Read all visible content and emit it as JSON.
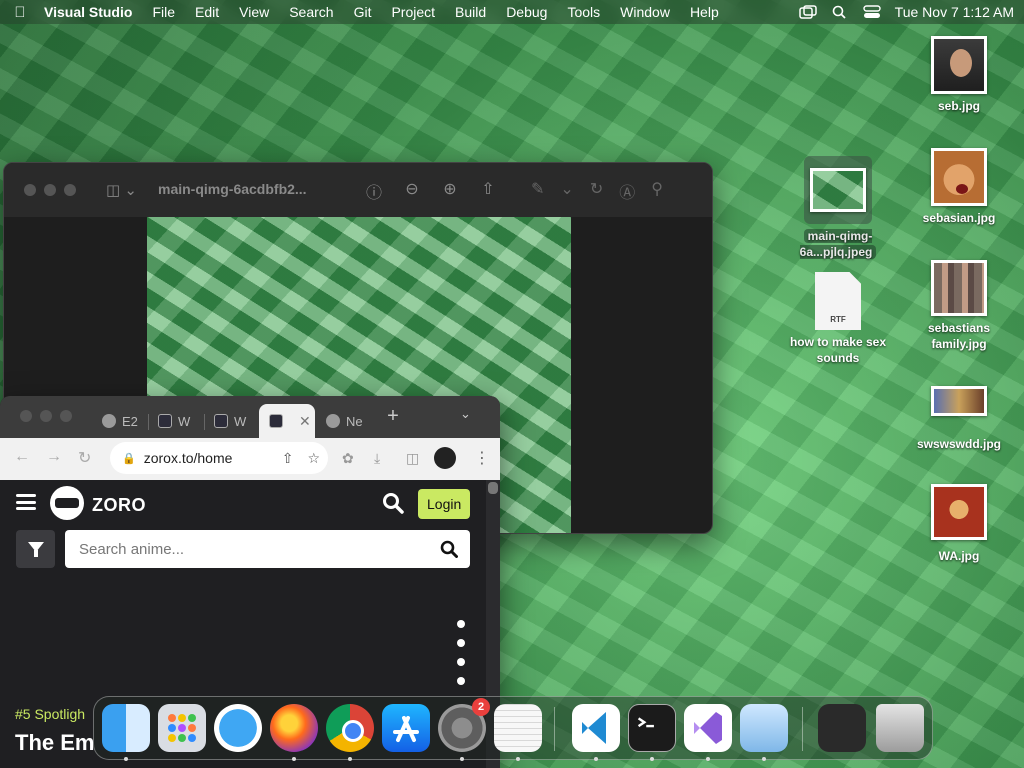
{
  "menubar": {
    "app_name": "Visual Studio",
    "menus": [
      "File",
      "Edit",
      "View",
      "Search",
      "Git",
      "Project",
      "Build",
      "Debug",
      "Tools",
      "Window",
      "Help"
    ],
    "clock": "Tue Nov 7  1:12 AM"
  },
  "desktop": {
    "icons": [
      {
        "label": "seb.jpg"
      },
      {
        "label": "sebasian.jpg"
      },
      {
        "label": "sebastians family.jpg"
      },
      {
        "label": "swswswdd.jpg"
      },
      {
        "label": "WA.jpg"
      },
      {
        "label": "main-qimg-6a...pjlq.jpeg"
      },
      {
        "label": "how to make sex sounds"
      }
    ],
    "rtf_badge": "RTF"
  },
  "preview_window": {
    "title": "main-qimg-6acdbfb2..."
  },
  "browser": {
    "tabs": [
      {
        "label": "E2"
      },
      {
        "label": "W"
      },
      {
        "label": "W"
      },
      {
        "label": ""
      },
      {
        "label": "Ne"
      }
    ],
    "url": "zorox.to/home",
    "site": {
      "logo_text": "ZORO",
      "login_label": "Login",
      "search_placeholder": "Search anime...",
      "spotlight": "#5 Spotligh",
      "title": "The Em"
    }
  },
  "dock": {
    "apps": [
      "Finder",
      "Launchpad",
      "Safari",
      "Firefox",
      "Google Chrome",
      "App Store",
      "System Settings",
      "TextEdit",
      "Visual Studio Code",
      "Terminal",
      "Visual Studio",
      "Preview",
      "Downloads",
      "Trash"
    ],
    "settings_badge": "2"
  }
}
